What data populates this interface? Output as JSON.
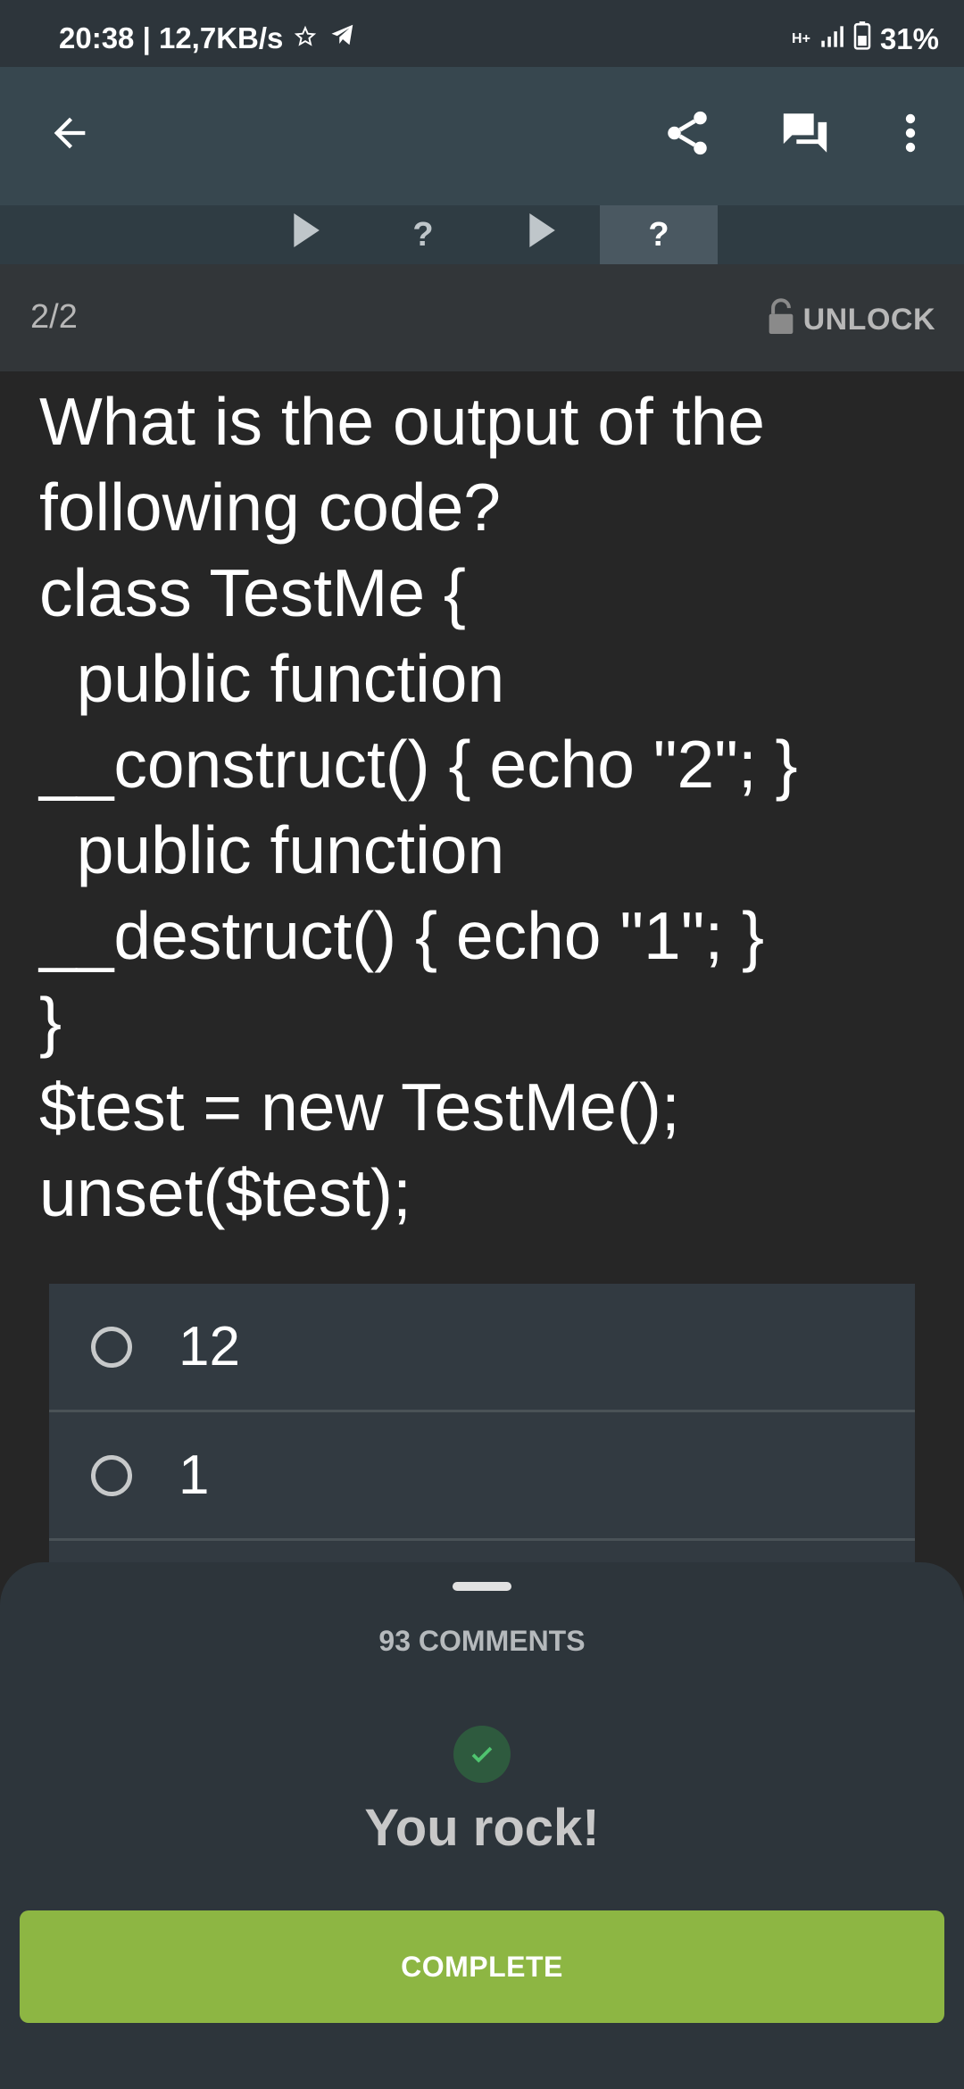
{
  "status": {
    "time_speed": "20:38 | 12,7KB/s",
    "network": "H+",
    "battery": "31%"
  },
  "toolbar": {
    "back_icon": "arrow-left-icon",
    "share_icon": "share-icon",
    "comments_icon": "chat-icon",
    "menu_icon": "more-vert-icon"
  },
  "tabs": [
    {
      "label": "▶",
      "active": false
    },
    {
      "label": "?",
      "active": false
    },
    {
      "label": "▶",
      "active": false
    },
    {
      "label": "?",
      "active": true
    }
  ],
  "progress": {
    "counter": "2/2",
    "unlock_label": "UNLOCK"
  },
  "question": {
    "text": "What is the output of the\nfollowing code?\nclass TestMe {\n  public function\n__construct() { echo \"2\"; }\n  public function\n__destruct() { echo \"1\"; }\n}\n$test = new TestMe();\nunset($test);"
  },
  "answers": [
    {
      "label": "12"
    },
    {
      "label": "1"
    },
    {
      "label": ""
    }
  ],
  "sheet": {
    "comments_label": "93 COMMENTS",
    "result_text": "You rock!",
    "complete_label": "COMPLETE"
  },
  "colors": {
    "accent_green": "#8db643",
    "appbar": "#37474f"
  }
}
